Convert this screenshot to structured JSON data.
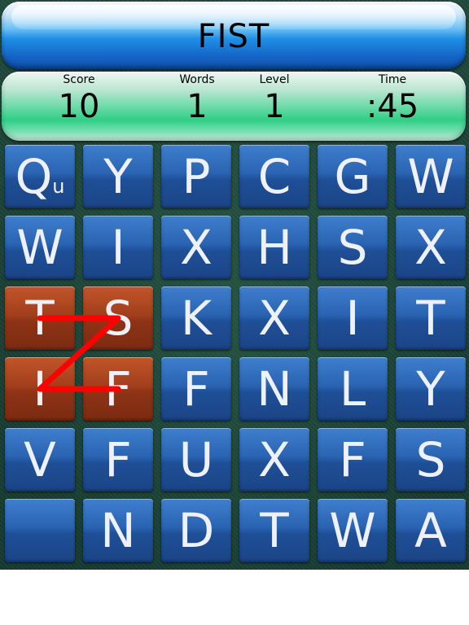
{
  "current_word": "FIST",
  "stats": {
    "score": {
      "label": "Score",
      "value": "10"
    },
    "words": {
      "label": "Words",
      "value": "1"
    },
    "level": {
      "label": "Level",
      "value": "1"
    },
    "time": {
      "label": "Time",
      "value": ":45"
    }
  },
  "grid": {
    "rows": [
      [
        {
          "l": "Q",
          "sub": "u"
        },
        {
          "l": "Y"
        },
        {
          "l": "P"
        },
        {
          "l": "C"
        },
        {
          "l": "G"
        },
        {
          "l": "W"
        }
      ],
      [
        {
          "l": "W"
        },
        {
          "l": "I"
        },
        {
          "l": "X"
        },
        {
          "l": "H"
        },
        {
          "l": "S"
        },
        {
          "l": "X"
        }
      ],
      [
        {
          "l": "T",
          "sel": true
        },
        {
          "l": "S",
          "sel": true
        },
        {
          "l": "K"
        },
        {
          "l": "X"
        },
        {
          "l": "I"
        },
        {
          "l": "T"
        }
      ],
      [
        {
          "l": "I",
          "sel": true
        },
        {
          "l": "F",
          "sel": true
        },
        {
          "l": "F"
        },
        {
          "l": "N"
        },
        {
          "l": "L"
        },
        {
          "l": "Y"
        }
      ],
      [
        {
          "l": "V"
        },
        {
          "l": "F"
        },
        {
          "l": "U"
        },
        {
          "l": "X"
        },
        {
          "l": "F"
        },
        {
          "l": "S"
        }
      ],
      [
        {
          "l": ""
        },
        {
          "l": "N"
        },
        {
          "l": "D"
        },
        {
          "l": "T"
        },
        {
          "l": "W"
        },
        {
          "l": "A"
        }
      ]
    ]
  },
  "colors": {
    "tile": "#2a63b2",
    "tile_selected": "#a23f1c",
    "path_stroke": "#ff0000"
  },
  "selection_path": [
    {
      "row": 2,
      "col": 0
    },
    {
      "row": 2,
      "col": 1
    },
    {
      "row": 3,
      "col": 0
    },
    {
      "row": 3,
      "col": 1
    }
  ]
}
